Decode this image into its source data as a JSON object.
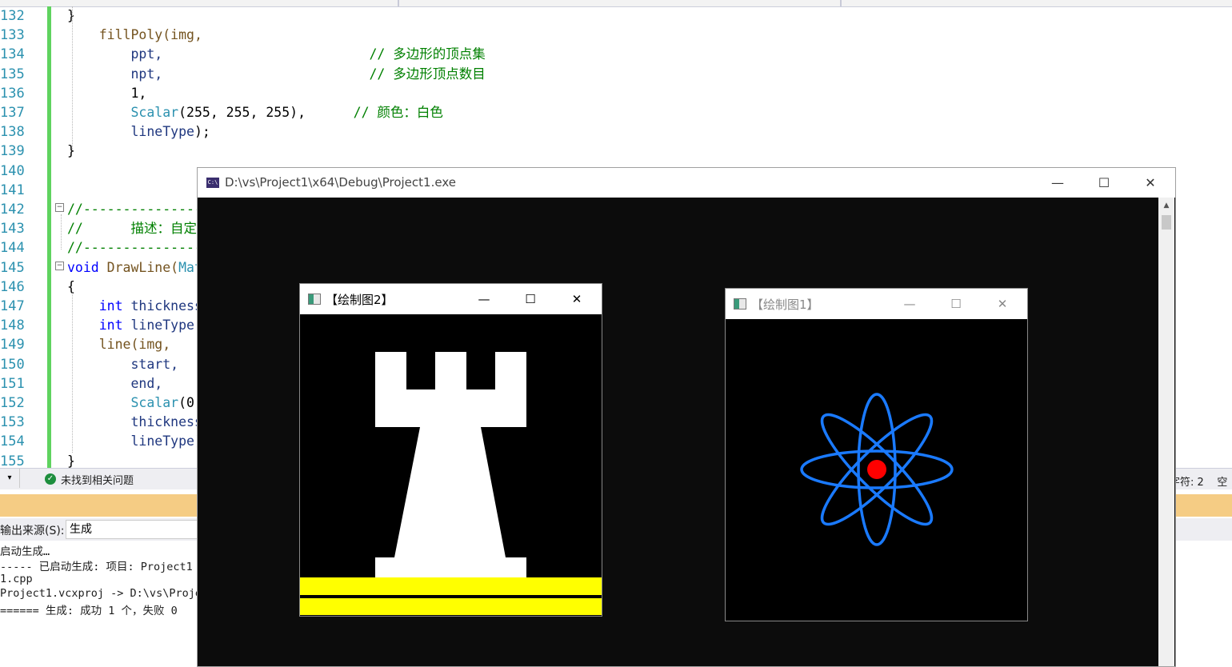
{
  "editor": {
    "lines": [
      {
        "num": "132",
        "tokens": [
          {
            "t": "}",
            "c": "p"
          }
        ]
      },
      {
        "num": "133",
        "tokens": [
          {
            "t": "    fillPoly(img,",
            "c": "fn"
          }
        ]
      },
      {
        "num": "134",
        "tokens": [
          {
            "t": "        ppt,",
            "c": "id"
          },
          {
            "t": "                          // 多边形的顶点集",
            "c": "cm"
          }
        ]
      },
      {
        "num": "135",
        "tokens": [
          {
            "t": "        npt,",
            "c": "id"
          },
          {
            "t": "                          // 多边形顶点数目",
            "c": "cm"
          }
        ]
      },
      {
        "num": "136",
        "tokens": [
          {
            "t": "        1,",
            "c": "p"
          }
        ]
      },
      {
        "num": "137",
        "tokens": [
          {
            "t": "        Scalar",
            "c": "ty"
          },
          {
            "t": "(255, 255, 255),",
            "c": "p"
          },
          {
            "t": "      // 颜色：白色",
            "c": "cm"
          }
        ]
      },
      {
        "num": "138",
        "tokens": [
          {
            "t": "        lineType",
            "c": "id"
          },
          {
            "t": ");",
            "c": "p"
          }
        ]
      },
      {
        "num": "139",
        "tokens": [
          {
            "t": "}",
            "c": "p"
          }
        ]
      },
      {
        "num": "140",
        "tokens": []
      },
      {
        "num": "141",
        "tokens": []
      },
      {
        "num": "142",
        "tokens": [
          {
            "t": "//------------------------------",
            "c": "cm"
          }
        ]
      },
      {
        "num": "143",
        "tokens": [
          {
            "t": "//      描述：自定",
            "c": "cm"
          }
        ]
      },
      {
        "num": "144",
        "tokens": [
          {
            "t": "//------------------------------",
            "c": "cm"
          }
        ]
      },
      {
        "num": "145",
        "tokens": [
          {
            "t": "void",
            "c": "kw"
          },
          {
            "t": " DrawLine(",
            "c": "fn"
          },
          {
            "t": "Mat",
            "c": "ty"
          }
        ]
      },
      {
        "num": "146",
        "tokens": [
          {
            "t": "{",
            "c": "p"
          }
        ]
      },
      {
        "num": "147",
        "tokens": [
          {
            "t": "    int",
            "c": "kw"
          },
          {
            "t": " thickness",
            "c": "id"
          }
        ]
      },
      {
        "num": "148",
        "tokens": [
          {
            "t": "    int",
            "c": "kw"
          },
          {
            "t": " lineType",
            "c": "id"
          }
        ]
      },
      {
        "num": "149",
        "tokens": [
          {
            "t": "    line(img,",
            "c": "fn"
          }
        ]
      },
      {
        "num": "150",
        "tokens": [
          {
            "t": "        start,",
            "c": "id"
          }
        ]
      },
      {
        "num": "151",
        "tokens": [
          {
            "t": "        end,",
            "c": "id"
          }
        ]
      },
      {
        "num": "152",
        "tokens": [
          {
            "t": "        Scalar",
            "c": "ty"
          },
          {
            "t": "(0,",
            "c": "p"
          }
        ]
      },
      {
        "num": "153",
        "tokens": [
          {
            "t": "        thickness",
            "c": "id"
          }
        ]
      },
      {
        "num": "154",
        "tokens": [
          {
            "t": "        lineType)",
            "c": "id"
          }
        ]
      },
      {
        "num": "155",
        "tokens": [
          {
            "t": "}",
            "c": "p"
          }
        ]
      }
    ]
  },
  "status": {
    "ok_text": "未找到相关问题",
    "right_text": "字符: 2    空"
  },
  "output": {
    "source_label": "输出来源(S):",
    "source_value": "生成",
    "lines": [
      "启动生成…",
      "----- 已启动生成: 项目: Project1",
      "1.cpp",
      "Project1.vcxproj -> D:\\vs\\Project",
      "====== 生成: 成功 1 个，失败 0"
    ]
  },
  "console": {
    "title": "D:\\vs\\Project1\\x64\\Debug\\Project1.exe",
    "icon_text": "C:\\",
    "minimize_glyph": "—",
    "maximize_glyph": "☐",
    "close_glyph": "✕"
  },
  "window_rook": {
    "title": "【绘制图2】",
    "minimize_glyph": "—",
    "maximize_glyph": "☐",
    "close_glyph": "✕",
    "rook_color": "#ffffff",
    "base_color": "#ffff00"
  },
  "window_atom": {
    "title": "【绘制图1】",
    "minimize_glyph": "—",
    "maximize_glyph": "☐",
    "close_glyph": "✕",
    "orbit_color": "#1a7aff",
    "nucleus_color": "#ff0000",
    "orbit_angles_deg": [
      0,
      45,
      90,
      -45
    ]
  }
}
